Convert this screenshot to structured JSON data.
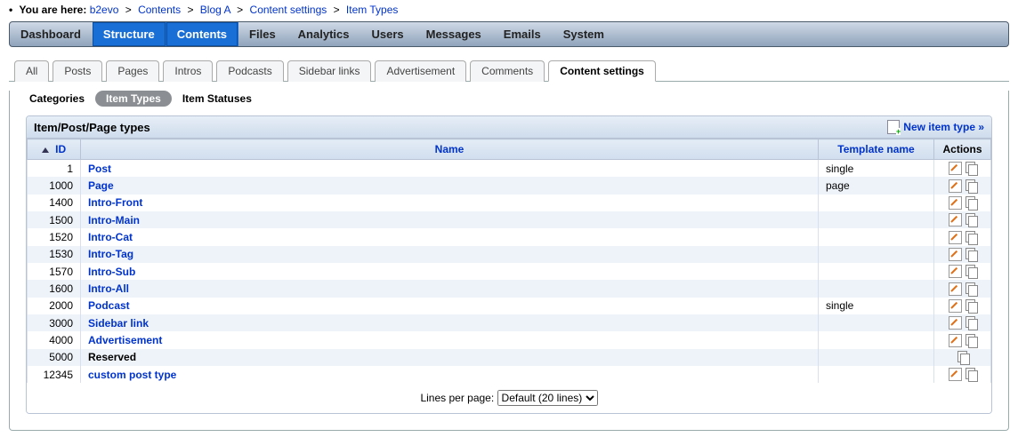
{
  "breadcrumb": {
    "label": "You are here:",
    "items": [
      "b2evo",
      "Contents",
      "Blog A",
      "Content settings",
      "Item Types"
    ]
  },
  "mainTabs": [
    {
      "label": "Dashboard",
      "selected": false
    },
    {
      "label": "Structure",
      "selected": true
    },
    {
      "label": "Contents",
      "selected": true
    },
    {
      "label": "Files",
      "selected": false
    },
    {
      "label": "Analytics",
      "selected": false
    },
    {
      "label": "Users",
      "selected": false
    },
    {
      "label": "Messages",
      "selected": false
    },
    {
      "label": "Emails",
      "selected": false
    },
    {
      "label": "System",
      "selected": false
    }
  ],
  "subTabs": [
    {
      "label": "All",
      "active": false
    },
    {
      "label": "Posts",
      "active": false
    },
    {
      "label": "Pages",
      "active": false
    },
    {
      "label": "Intros",
      "active": false
    },
    {
      "label": "Podcasts",
      "active": false
    },
    {
      "label": "Sidebar links",
      "active": false
    },
    {
      "label": "Advertisement",
      "active": false
    },
    {
      "label": "Comments",
      "active": false
    },
    {
      "label": "Content settings",
      "active": true
    }
  ],
  "pillTabs": [
    {
      "label": "Categories",
      "style": "plain"
    },
    {
      "label": "Item Types",
      "style": "pill"
    },
    {
      "label": "Item Statuses",
      "style": "plain"
    }
  ],
  "panel": {
    "title": "Item/Post/Page types",
    "newLink": "New item type »"
  },
  "columns": {
    "id": "ID",
    "name": "Name",
    "template": "Template name",
    "actions": "Actions"
  },
  "rows": [
    {
      "id": "1",
      "name": "Post",
      "link": true,
      "template": "single",
      "edit": true,
      "copy": true
    },
    {
      "id": "1000",
      "name": "Page",
      "link": true,
      "template": "page",
      "edit": true,
      "copy": true
    },
    {
      "id": "1400",
      "name": "Intro-Front",
      "link": true,
      "template": "",
      "edit": true,
      "copy": true
    },
    {
      "id": "1500",
      "name": "Intro-Main",
      "link": true,
      "template": "",
      "edit": true,
      "copy": true
    },
    {
      "id": "1520",
      "name": "Intro-Cat",
      "link": true,
      "template": "",
      "edit": true,
      "copy": true
    },
    {
      "id": "1530",
      "name": "Intro-Tag",
      "link": true,
      "template": "",
      "edit": true,
      "copy": true
    },
    {
      "id": "1570",
      "name": "Intro-Sub",
      "link": true,
      "template": "",
      "edit": true,
      "copy": true
    },
    {
      "id": "1600",
      "name": "Intro-All",
      "link": true,
      "template": "",
      "edit": true,
      "copy": true
    },
    {
      "id": "2000",
      "name": "Podcast",
      "link": true,
      "template": "single",
      "edit": true,
      "copy": true
    },
    {
      "id": "3000",
      "name": "Sidebar link",
      "link": true,
      "template": "",
      "edit": true,
      "copy": true
    },
    {
      "id": "4000",
      "name": "Advertisement",
      "link": true,
      "template": "",
      "edit": true,
      "copy": true
    },
    {
      "id": "5000",
      "name": "Reserved",
      "link": false,
      "template": "",
      "edit": false,
      "copy": true
    },
    {
      "id": "12345",
      "name": "custom post type",
      "link": true,
      "template": "",
      "edit": true,
      "copy": true
    }
  ],
  "pager": {
    "label": "Lines per page:",
    "selected": "Default (20 lines)"
  }
}
